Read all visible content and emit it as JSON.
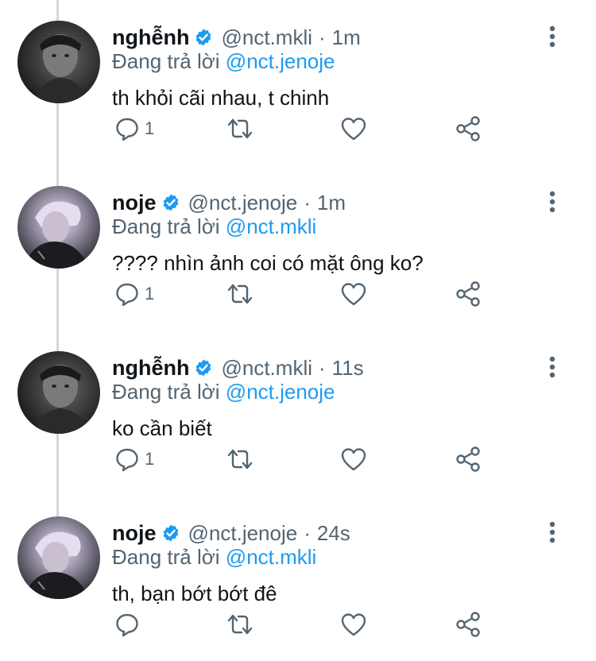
{
  "reply_prefix": "Đang trả lời",
  "tweets": [
    {
      "name": "nghễnh",
      "handle": "@nct.mkli",
      "dot": "·",
      "time": "1m",
      "reply_to": "@nct.jenoje",
      "text": "th khỏi cãi nhau, t chinh",
      "reply_count": "1",
      "avatar": "avatar-dark"
    },
    {
      "name": "noje",
      "handle": "@nct.jenoje",
      "dot": "·",
      "time": "1m",
      "reply_to": "@nct.mkli",
      "text": "???? nhìn ảnh coi có mặt ông ko?",
      "reply_count": "1",
      "avatar": "avatar-light"
    },
    {
      "name": "nghễnh",
      "handle": "@nct.mkli",
      "dot": "·",
      "time": "11s",
      "reply_to": "@nct.jenoje",
      "text": "ko cần biết",
      "reply_count": "1",
      "avatar": "avatar-dark"
    },
    {
      "name": "noje",
      "handle": "@nct.jenoje",
      "dot": "·",
      "time": "24s",
      "reply_to": "@nct.mkli",
      "text": "th, bạn bớt bớt đê",
      "reply_count": "",
      "avatar": "avatar-light"
    }
  ],
  "icons": {
    "verified": "verified-badge-icon",
    "more": "more-vertical-icon",
    "reply": "comment-icon",
    "retweet": "retweet-icon",
    "like": "heart-icon",
    "share": "share-icon"
  },
  "colors": {
    "accent": "#1d9bf0",
    "secondary_text": "#536471",
    "primary_text": "#0f1419",
    "thread_line": "#cfd9de"
  }
}
